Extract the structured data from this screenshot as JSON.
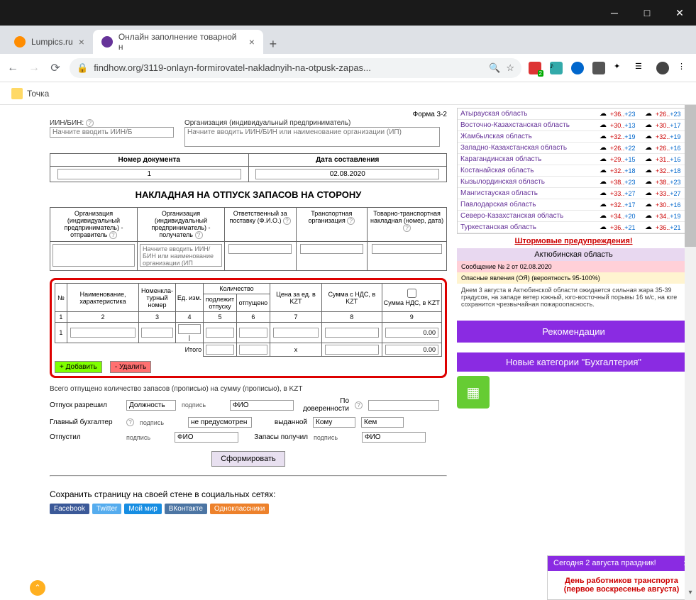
{
  "browser": {
    "tabs": [
      {
        "title": "Lumpics.ru",
        "favicon_color": "#ff8c00"
      },
      {
        "title": "Онлайн заполнение товарной н",
        "favicon_color": "#663399"
      }
    ],
    "url_display": "findhow.org/3119-onlayn-formirovatel-nakladnyih-na-otpusk-zapas...",
    "ext_badge": "2",
    "bookmark": "Точка"
  },
  "form": {
    "form_no": "Форма 3-2",
    "iin_label": "ИИН/БИН:",
    "iin_placeholder": "Начните вводить ИИН/Б",
    "org_label": "Организация (индивидуальный предприниматель)",
    "org_placeholder": "Начните вводить ИИН/БИН или наименование организации (ИП)",
    "doc_no_label": "Номер документа",
    "doc_no_value": "1",
    "date_label": "Дата составления",
    "date_value": "02.08.2020",
    "title": "НАКЛАДНАЯ НА ОТПУСК ЗАПАСОВ НА СТОРОНУ",
    "org_headers": [
      "Организация (индивидуальный предприниматель) - отправитель",
      "Организация (индивидуальный предприниматель) - получатель",
      "Ответственный за поставку (Ф.И.О.)",
      "Транспортная организация",
      "Товарно-транспортная накладная (номер, дата)"
    ],
    "org_recv_placeholder": "Начните вводить ИИН/БИН или наименование организации (ИП",
    "items_headers": {
      "no": "№",
      "name": "Наименование, характеристика",
      "nomen": "Номенкла-\nтурный номер",
      "unit": "Ед. изм.",
      "qty": "Количество",
      "qty_due": "подлежит отпуску",
      "qty_rel": "отпущено",
      "price": "Цена за ед. в KZT",
      "sum_vat": "Сумма с НДС, в KZT",
      "vat": "Сумма НДС, в KZT"
    },
    "col_nums": [
      "1",
      "2",
      "3",
      "4",
      "5",
      "6",
      "7",
      "8",
      "9"
    ],
    "row1_no": "1",
    "total_label": "Итого",
    "total_x": "x",
    "total_val": "0.00",
    "row_val": "0.00",
    "btn_add": "+ Добавить",
    "btn_del": "- Удалить",
    "total_text": "Всего отпущено количество запасов (прописью) на сумму (прописью), в KZT",
    "sig": {
      "release": "Отпуск разрешил",
      "position": "Должность",
      "sign": "подпись",
      "fio": "ФИО",
      "by_proxy": "По доверенности",
      "chief": "Главный бухгалтер",
      "not_provided": "не предусмотрен",
      "issued": "выданной",
      "whom": "Кому",
      "by_whom": "Кем",
      "released": "Отпустил",
      "received": "Запасы получил"
    },
    "btn_generate": "Сформировать",
    "social_label": "Сохранить страницу на своей стене в социальных сетях:",
    "social": [
      "Facebook",
      "Twitter",
      "Мой мир",
      "ВКонтакте",
      "Одноклассники"
    ]
  },
  "weather": {
    "regions": [
      {
        "name": "Атырауская область",
        "d1": "+36..+23",
        "d2": "+26..+23"
      },
      {
        "name": "Восточно-Казахстанская область",
        "d1": "+30..+13",
        "d2": "+30..+17"
      },
      {
        "name": "Жамбылская область",
        "d1": "+32..+19",
        "d2": "+32..+19"
      },
      {
        "name": "Западно-Казахстанская область",
        "d1": "+26..+22",
        "d2": "+26..+16"
      },
      {
        "name": "Карагандинская область",
        "d1": "+29..+15",
        "d2": "+31..+16"
      },
      {
        "name": "Костанайская область",
        "d1": "+32..+18",
        "d2": "+32..+18"
      },
      {
        "name": "Кызылординская область",
        "d1": "+38..+23",
        "d2": "+38..+23"
      },
      {
        "name": "Мангистауская область",
        "d1": "+33..+27",
        "d2": "+33..+27"
      },
      {
        "name": "Павлодарская область",
        "d1": "+32..+17",
        "d2": "+30..+16"
      },
      {
        "name": "Северо-Казахстанская область",
        "d1": "+34..+20",
        "d2": "+34..+19"
      },
      {
        "name": "Туркестанская область",
        "d1": "+36..+21",
        "d2": "+36..+21"
      }
    ],
    "storm": "Штормовые предупреждения!",
    "region_hdr": "Актюбинская область",
    "msg": "Сообщение № 2 от 02.08.2020",
    "warn": "Опасные явления (ОЯ) (вероятность 95-100%)",
    "desc": "Днем 3 августа в Актюбинской области ожидается сильная жара 35-39 градусов, на западе ветер южный, юго-восточный порывы 16 м/с, на юге сохранится чрезвычайная пожароопасность."
  },
  "sidebar": {
    "reco": "Рекомендации",
    "newcat": "Новые категории \"Бухгалтерия\""
  },
  "popup": {
    "header": "Сегодня 2 августа праздник!",
    "body": "День работников транспорта (первое воскресенье августа)"
  }
}
